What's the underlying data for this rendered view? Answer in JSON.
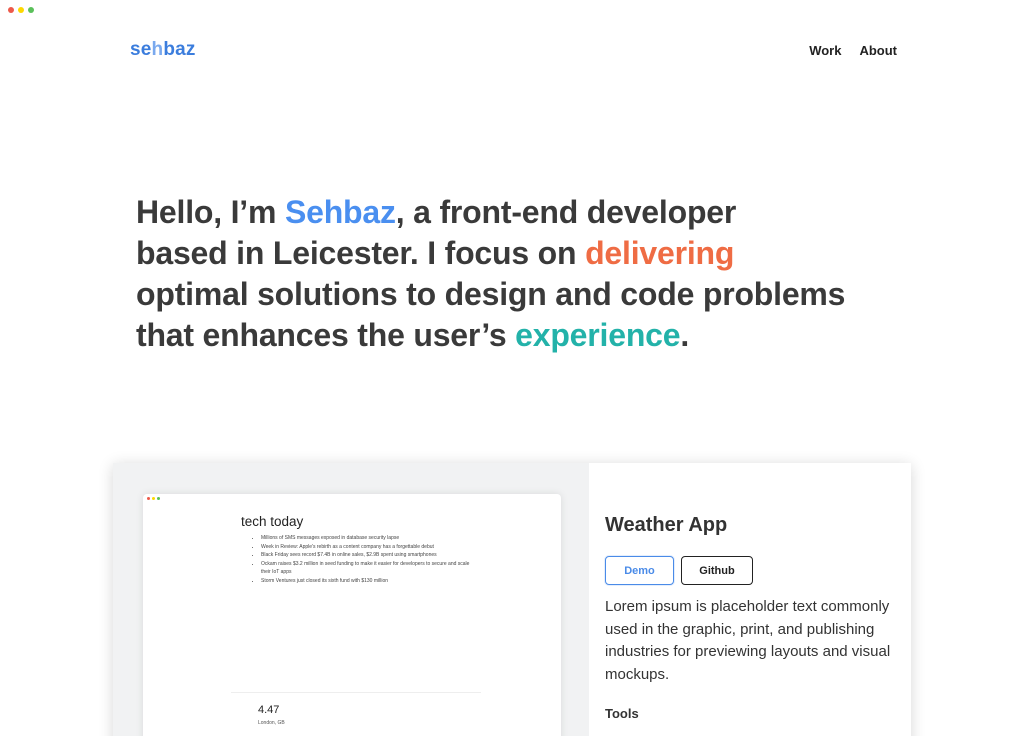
{
  "window": {
    "dot_colors": [
      "#ed594a",
      "#fdd800",
      "#5ac05a"
    ]
  },
  "nav": {
    "logo_part1": "se",
    "logo_part2": "h",
    "logo_part3": "baz",
    "links": [
      {
        "label": "Work"
      },
      {
        "label": "About"
      }
    ]
  },
  "hero": {
    "line1_a": "Hello, I’m ",
    "line1_highlight": "Sehbaz",
    "line1_b": ", a front-end developer",
    "line2_a": "based in Leicester. I focus on ",
    "line2_highlight": "delivering",
    "line3": "optimal solutions to design and code problems",
    "line4_a": "that enhances the user’s ",
    "line4_highlight": "experience",
    "line4_b": ".",
    "colors": {
      "name": "#4a8ff0",
      "delivering": "#ef6c44",
      "experience": "#23b2a9"
    }
  },
  "project": {
    "title": "Weather App",
    "demo_label": "Demo",
    "github_label": "Github",
    "description": "Lorem ipsum is placeholder text commonly used in the graphic, print, and publishing industries for previewing layouts and visual mockups.",
    "tools_label": "Tools",
    "preview": {
      "title": "tech today",
      "headlines": [
        "Millions of SMS messages exposed in database security lapse",
        "Week in Review: Apple's rebirth as a content company has a forgettable debut",
        "Black Friday sees record $7.4B in online sales, $2.9B spent using smartphones",
        "Ockam raises $3.2 million in seed funding to make it easier for developers to secure and scale their IoT apps",
        "Storm Ventures just closed its sixth fund with $130 million"
      ],
      "temperature": "4.47",
      "location": "London, GB"
    }
  }
}
